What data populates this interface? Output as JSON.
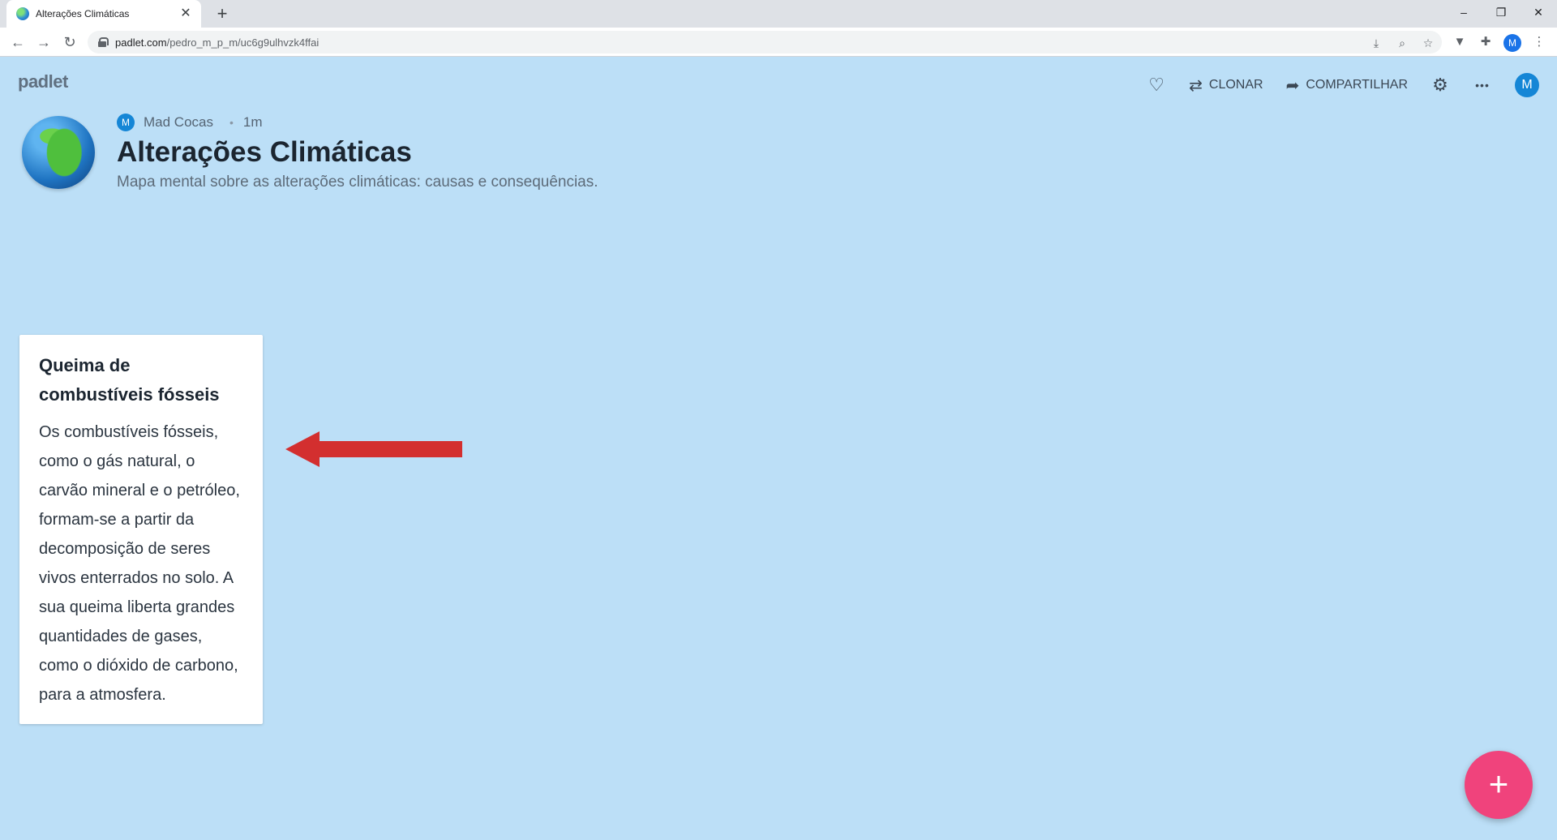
{
  "browser": {
    "tab_title": "Alterações Climáticas",
    "tab_close": "✕",
    "new_tab": "+",
    "url_host": "padlet.com",
    "url_path": "/pedro_m_p_m/uc6g9ulhvzk4ffai",
    "profile_initial": "M",
    "window_controls": {
      "minimize": "–",
      "maximize": "❐",
      "close": "✕"
    },
    "nav": {
      "back": "←",
      "forward": "→",
      "reload": "↻"
    }
  },
  "padlet": {
    "logo": "padlet",
    "actions": {
      "like_icon": "♡",
      "clone_label": "CLONAR",
      "clone_icon": "⇄",
      "share_label": "COMPARTILHAR",
      "share_icon": "➦",
      "settings_icon": "⚙",
      "more_icon": "•••",
      "avatar_initial": "M"
    },
    "board": {
      "author_initial": "M",
      "author": "Mad Cocas",
      "time": "1m",
      "title": "Alterações Climáticas",
      "description": "Mapa mental sobre as alterações climáticas: causas e consequências."
    },
    "post": {
      "title": "Queima de combustíveis fósseis",
      "body": "Os combustíveis fósseis, como o gás natural, o carvão mineral e o petróleo, formam-se a partir da decomposição de seres vivos enterrados no solo. A sua queima liberta grandes quantidades de gases, como o dióxido de carbono, para a atmosfera."
    },
    "fab_label": "+"
  },
  "colors": {
    "background": "#bcdff7",
    "arrow": "#d32f2f",
    "fab": "#f0437c",
    "avatar": "#1586d6"
  }
}
